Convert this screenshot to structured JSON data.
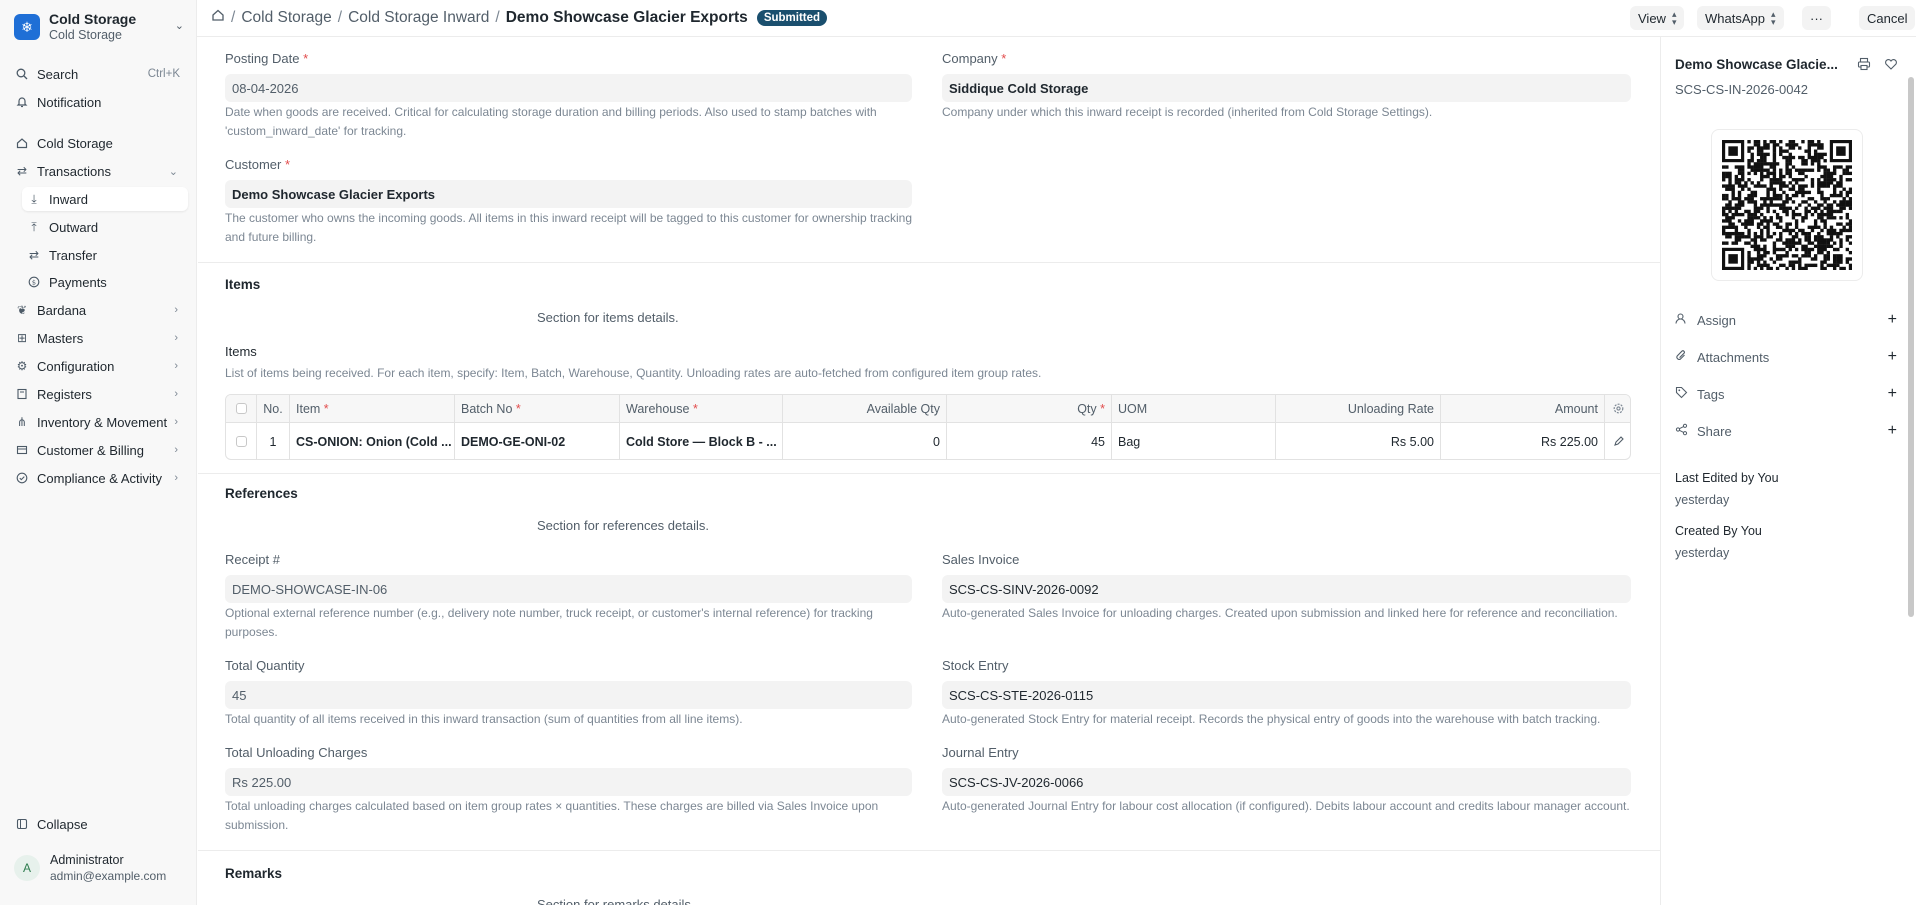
{
  "sidebar": {
    "brand_title": "Cold Storage",
    "brand_sub": "Cold Storage",
    "search_label": "Search",
    "search_shortcut": "Ctrl+K",
    "notification_label": "Notification",
    "items": [
      {
        "label": "Cold Storage"
      },
      {
        "label": "Transactions"
      },
      {
        "label": "Inward"
      },
      {
        "label": "Outward"
      },
      {
        "label": "Transfer"
      },
      {
        "label": "Payments"
      },
      {
        "label": "Bardana"
      },
      {
        "label": "Masters"
      },
      {
        "label": "Configuration"
      },
      {
        "label": "Registers"
      },
      {
        "label": "Inventory & Movement"
      },
      {
        "label": "Customer & Billing"
      },
      {
        "label": "Compliance & Activity"
      }
    ],
    "collapse_label": "Collapse",
    "user_initial": "A",
    "user_name": "Administrator",
    "user_email": "admin@example.com"
  },
  "topbar": {
    "crumb1": "Cold Storage",
    "crumb2": "Cold Storage Inward",
    "title": "Demo Showcase Glacier Exports",
    "status": "Submitted",
    "view_label": "View",
    "whatsapp_label": "WhatsApp",
    "more_label": "···",
    "cancel_label": "Cancel"
  },
  "form": {
    "posting_date_label": "Posting Date",
    "posting_date_value": "08-04-2026",
    "posting_date_desc": "Date when goods are received. Critical for calculating storage duration and billing periods. Also used to stamp batches with 'custom_inward_date' for tracking.",
    "company_label": "Company",
    "company_value": "Siddique Cold Storage",
    "company_desc": "Company under which this inward receipt is recorded (inherited from Cold Storage Settings).",
    "customer_label": "Customer",
    "customer_value": "Demo Showcase Glacier Exports",
    "customer_desc": "The customer who owns the incoming goods. All items in this inward receipt will be tagged to this customer for ownership tracking and future billing.",
    "items_section": "Items",
    "items_section_note": "Section for items details.",
    "items_table_label": "Items",
    "items_table_desc": "List of items being received. For each item, specify: Item, Batch, Warehouse, Quantity. Unloading rates are auto-fetched from configured item group rates.",
    "table_headers": {
      "no": "No.",
      "item": "Item",
      "batch": "Batch No",
      "warehouse": "Warehouse",
      "available": "Available Qty",
      "qty": "Qty",
      "uom": "UOM",
      "rate": "Unloading Rate",
      "amount": "Amount"
    },
    "rows": [
      {
        "no": "1",
        "item": "CS-ONION: Onion (Cold ...",
        "batch": "DEMO-GE-ONI-02",
        "warehouse": "Cold Store — Block B - ...",
        "available": "0",
        "qty": "45",
        "uom": "Bag",
        "rate": "Rs 5.00",
        "amount": "Rs 225.00"
      }
    ],
    "references_section": "References",
    "references_note": "Section for references details.",
    "receipt_label": "Receipt #",
    "receipt_value": "DEMO-SHOWCASE-IN-06",
    "receipt_desc": "Optional external reference number (e.g., delivery note number, truck receipt, or customer's internal reference) for tracking purposes.",
    "sales_invoice_label": "Sales Invoice",
    "sales_invoice_value": "SCS-CS-SINV-2026-0092",
    "sales_invoice_desc": "Auto-generated Sales Invoice for unloading charges. Created upon submission and linked here for reference and reconciliation.",
    "total_qty_label": "Total Quantity",
    "total_qty_value": "45",
    "total_qty_desc": "Total quantity of all items received in this inward transaction (sum of quantities from all line items).",
    "stock_entry_label": "Stock Entry",
    "stock_entry_value": "SCS-CS-STE-2026-0115",
    "stock_entry_desc": "Auto-generated Stock Entry for material receipt. Records the physical entry of goods into the warehouse with batch tracking.",
    "unloading_label": "Total Unloading Charges",
    "unloading_value": "Rs 225.00",
    "unloading_desc": "Total unloading charges calculated based on item group rates × quantities. These charges are billed via Sales Invoice upon submission.",
    "journal_label": "Journal Entry",
    "journal_value": "SCS-CS-JV-2026-0066",
    "journal_desc": "Auto-generated Journal Entry for labour cost allocation (if configured). Debits labour account and credits labour manager account.",
    "remarks_section": "Remarks",
    "remarks_note": "Section for remarks details."
  },
  "right_panel": {
    "title": "Demo Showcase Glacie...",
    "doc_id": "SCS-CS-IN-2026-0042",
    "assign": "Assign",
    "attachments": "Attachments",
    "tags": "Tags",
    "share": "Share",
    "last_edited": "Last Edited by You",
    "last_edited_when": "yesterday",
    "created_by": "Created By You",
    "created_when": "yesterday"
  }
}
